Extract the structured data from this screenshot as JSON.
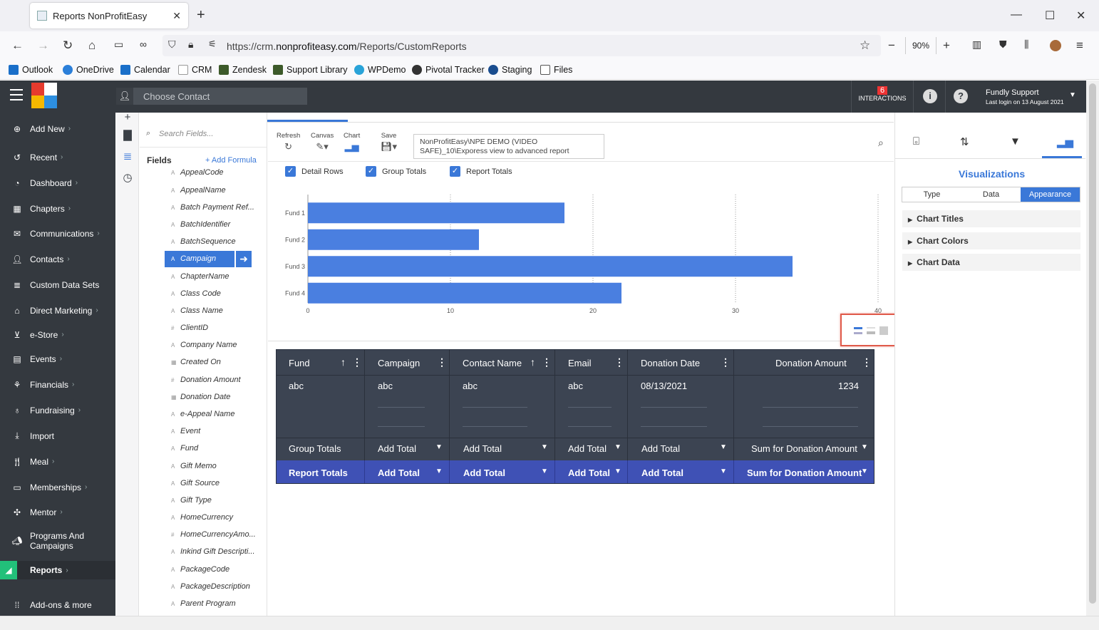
{
  "browser": {
    "tab_title": "Reports NonProfitEasy",
    "url_prefix": "https://crm.",
    "url_domain": "nonprofiteasy.com",
    "url_path": "/Reports/CustomReports",
    "zoom": "90%",
    "bookmarks": [
      "Outlook",
      "OneDrive",
      "Calendar",
      "CRM",
      "Zendesk",
      "Support Library",
      "WPDemo",
      "Pivotal Tracker",
      "Staging",
      "Files"
    ]
  },
  "header": {
    "contact_placeholder": "Choose Contact",
    "interactions_count": "6",
    "interactions_label": "INTERACTIONS",
    "user_name": "Fundly Support",
    "last_login": "Last login on 13 August 2021"
  },
  "sidebar": {
    "items": [
      {
        "label": "Add New",
        "icon": "plus-circle-icon"
      },
      {
        "label": "Recent",
        "icon": "history-icon"
      },
      {
        "label": "Dashboard",
        "icon": "dashboard-icon"
      },
      {
        "label": "Chapters",
        "icon": "grid-icon"
      },
      {
        "label": "Communications",
        "icon": "envelope-icon"
      },
      {
        "label": "Contacts",
        "icon": "user-icon"
      },
      {
        "label": "Custom Data Sets",
        "icon": "database-icon"
      },
      {
        "label": "Direct Marketing",
        "icon": "bank-icon"
      },
      {
        "label": "e-Store",
        "icon": "cart-icon"
      },
      {
        "label": "Events",
        "icon": "calendar-icon"
      },
      {
        "label": "Financials",
        "icon": "money-icon"
      },
      {
        "label": "Fundraising",
        "icon": "bag-icon"
      },
      {
        "label": "Import",
        "icon": "download-icon"
      },
      {
        "label": "Meal",
        "icon": "utensils-icon"
      },
      {
        "label": "Memberships",
        "icon": "card-icon"
      },
      {
        "label": "Mentor",
        "icon": "network-icon"
      },
      {
        "label": "Programs And Campaigns",
        "icon": "megaphone-icon"
      },
      {
        "label": "Reports",
        "icon": "chart-icon"
      },
      {
        "label": "Add-ons & more",
        "icon": "apps-icon"
      }
    ]
  },
  "fields_panel": {
    "search_placeholder": "Search Fields...",
    "title": "Fields",
    "add_formula": "+ Add Formula",
    "fields": [
      "AppealCode",
      "AppealName",
      "Batch Payment Ref...",
      "BatchIdentifier",
      "BatchSequence",
      "Campaign",
      "ChapterName",
      "Class Code",
      "Class Name",
      "ClientID",
      "Company Name",
      "Created On",
      "Donation Amount",
      "Donation Date",
      "e-Appeal Name",
      "Event",
      "Fund",
      "Gift Memo",
      "Gift Source",
      "Gift Type",
      "HomeCurrency",
      "HomeCurrencyAmo...",
      "Inkind Gift Descripti...",
      "PackageCode",
      "PackageDescription",
      "Parent Program"
    ],
    "selected": "Campaign"
  },
  "toolbar": {
    "refresh": "Refresh",
    "canvas": "Canvas",
    "chart": "Chart",
    "save": "Save",
    "tooltip_line1": "NonProfitEasy\\NPE DEMO (VIDEO",
    "tooltip_line2": "SAFE)_10\\Exporess view to advanced report"
  },
  "options": {
    "detail_rows": "Detail Rows",
    "group_totals": "Group Totals",
    "report_totals": "Report Totals"
  },
  "chart_data": {
    "type": "bar",
    "orientation": "horizontal",
    "categories": [
      "Fund 1",
      "Fund 2",
      "Fund 3",
      "Fund 4"
    ],
    "values": [
      18,
      12,
      34,
      22
    ],
    "xlim": [
      0,
      40
    ],
    "xticks": [
      0,
      10,
      20,
      30,
      40
    ],
    "grid": true,
    "bar_color": "#4a7fe0"
  },
  "table": {
    "headers": [
      "Fund",
      "Campaign",
      "Contact Name",
      "Email",
      "Donation Date",
      "Donation Amount"
    ],
    "row": [
      "abc",
      "abc",
      "abc",
      "abc",
      "08/13/2021",
      "1234"
    ],
    "group_totals_label": "Group Totals",
    "group_totals": [
      "Add Total",
      "Add Total",
      "Add Total",
      "Add Total",
      "Sum for Donation Amount"
    ],
    "report_totals_label": "Report Totals",
    "report_totals": [
      "Add Total",
      "Add Total",
      "Add Total",
      "Add Total",
      "Sum for Donation Amount"
    ]
  },
  "right_panel": {
    "title": "Visualizations",
    "tabs": [
      "Type",
      "Data",
      "Appearance"
    ],
    "active_tab": "Appearance",
    "sections": [
      "Chart Titles",
      "Chart Colors",
      "Chart Data"
    ]
  }
}
